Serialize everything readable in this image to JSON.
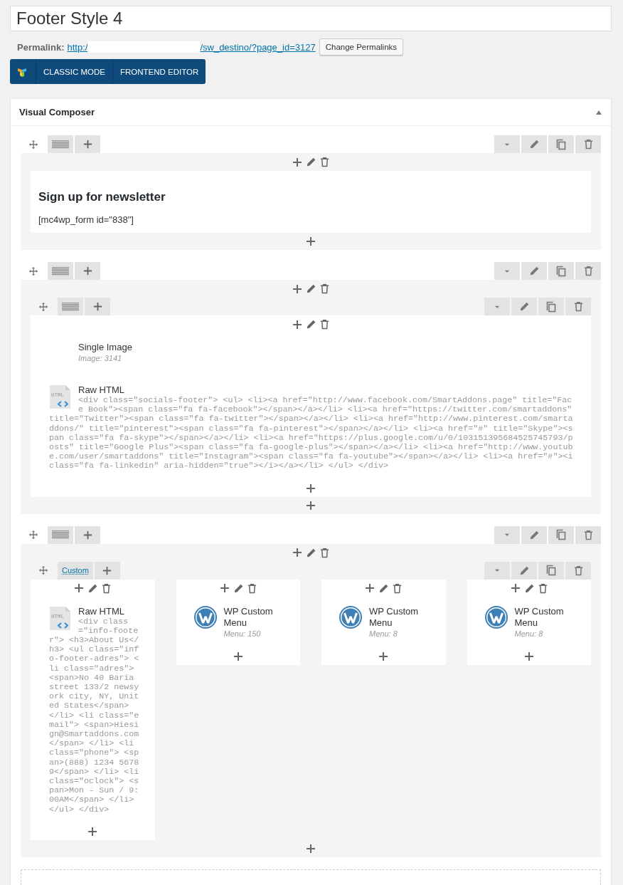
{
  "title_field": {
    "value": "Footer Style 4"
  },
  "permalink": {
    "label": "Permalink:",
    "url_start": "http:/",
    "url_end": "/sw_destino/?page_id=3127",
    "button": "Change Permalinks"
  },
  "mode_bar": {
    "buttons": [
      "CLASSIC MODE",
      "FRONTEND EDITOR"
    ]
  },
  "panel": {
    "title": "Visual Composer",
    "expanded": true
  },
  "rows": [
    {
      "columns": [
        {
          "elements": [
            {
              "kind": "text",
              "heading": "Sign up for newsletter",
              "body": "[mc4wp_form id=\"838\"]"
            }
          ]
        }
      ]
    },
    {
      "columns": [
        {
          "elements": [
            {
              "kind": "inner_row",
              "columns": [
                {
                  "elements": [
                    {
                      "kind": "image",
                      "title": "Single Image",
                      "meta": "Image: 3141"
                    },
                    {
                      "kind": "raw_html",
                      "title": "Raw HTML",
                      "icon_label": "HTML",
                      "code": "<div class=\"socials-footer\"> <ul> <li><a href=\"http://www.facebook.com/SmartAddons.page\" title=\"Face Book\"><span class=\"fa fa-facebook\"></span></a></li> <li><a href=\"https://twitter.com/smartaddons\" title=\"Twitter\"><span class=\"fa fa-twitter\"></span></a></li> <li><a href=\"http://www.pinterest.com/smartaddons/\" title=\"pinterest\"><span class=\"fa fa-pinterest\"></span></a></li> <li><a href=\"#\" title=\"Skype\"><span class=\"fa fa-skype\"></span></a></li> <li><a href=\"https://plus.google.com/u/0/103151395684525745793/posts\" title=\"Google Plus\"><span class=\"fa fa-google-plus\"></span></a></li> <li><a href=\"http://www.youtube.com/user/smartaddons\" title=\"Instagram\"><span class=\"fa fa-youtube\"></span></a></li> <li><a href=\"#\"><i class=\"fa fa-linkedin\" aria-hidden=\"true\"></i></a></li> </ul> </div>"
                    }
                  ]
                }
              ]
            }
          ]
        }
      ]
    },
    {
      "columns": [
        {
          "elements": [
            {
              "kind": "inner_row",
              "layout_label": "Custom",
              "columns": [
                {
                  "elements": [
                    {
                      "kind": "raw_html",
                      "title": "Raw HTML",
                      "icon_label": "HTML",
                      "code": "<div class=\"info-footer\"> <h3>About Us</h3> <ul class=\"info-footer-adres\"> <li class=\"adres\"> <span>No 40 Baria street 133/2 newsyork city, NY, United States</span> </li> <li class=\"email\"> <span>Hiesign@Smartaddons.com</span> </li> <li class=\"phone\"> <span>(888) 1234 56789</span> </li> <li class=\"oclock\"> <span>Mon - Sun / 9:00AM</span> </li> </ul> </div>"
                    }
                  ]
                },
                {
                  "elements": [
                    {
                      "kind": "wp_menu",
                      "title": "WP Custom Menu",
                      "meta": "Menu: 150"
                    }
                  ]
                },
                {
                  "elements": [
                    {
                      "kind": "wp_menu",
                      "title": "WP Custom Menu",
                      "meta": "Menu: 8"
                    }
                  ]
                },
                {
                  "elements": [
                    {
                      "kind": "wp_menu",
                      "title": "WP Custom Menu",
                      "meta": "Menu: 8"
                    }
                  ]
                }
              ]
            }
          ]
        }
      ]
    }
  ]
}
